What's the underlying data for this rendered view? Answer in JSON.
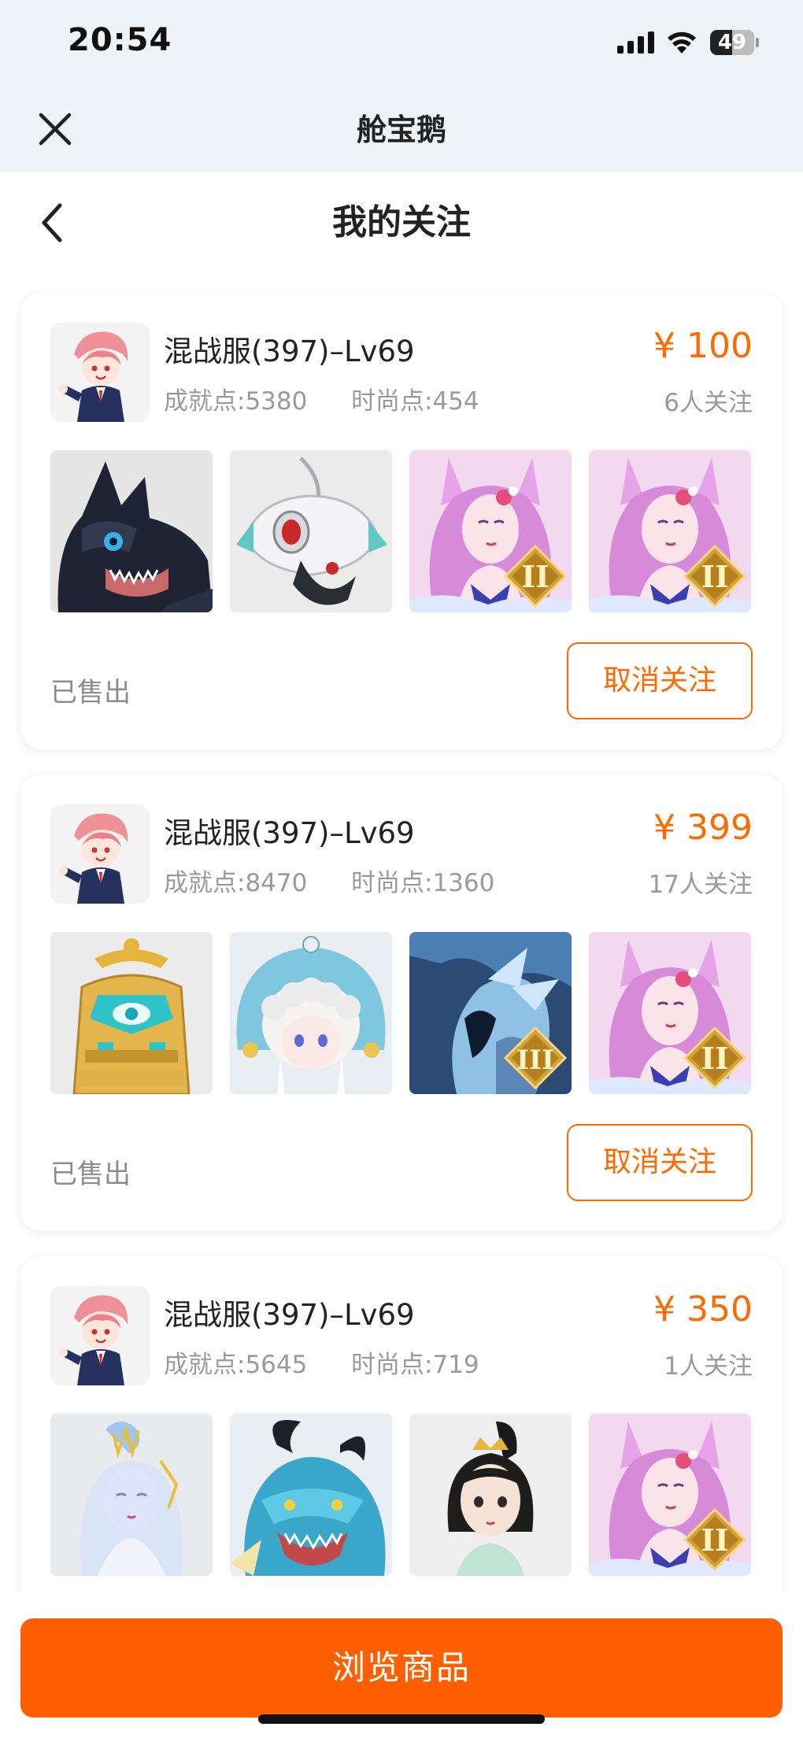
{
  "status_bar": {
    "time": "20:54",
    "battery": "49",
    "icons": [
      "signal-icon",
      "wifi-icon",
      "battery-icon"
    ]
  },
  "app_bar": {
    "title": "舱宝鹅",
    "close_icon": "close-icon"
  },
  "nav": {
    "title": "我的关注",
    "back_icon": "chevron-left-icon"
  },
  "cards": [
    {
      "title": "混战服(397)–Lv69",
      "achievement": "成就点:5380",
      "fashion": "时尚点:454",
      "price": "¥ 100",
      "followers": "6人关注",
      "status": "已售出",
      "action": "取消关注",
      "thumbnails": [
        "black-dragon-image",
        "white-mech-beast-image",
        "pink-fox-girl-tier-2-image",
        "pink-fox-girl-tier-2-image"
      ]
    },
    {
      "title": "混战服(397)–Lv69",
      "achievement": "成就点:8470",
      "fashion": "时尚点:1360",
      "price": "¥ 399",
      "followers": "17人关注",
      "status": "已售出",
      "action": "取消关注",
      "thumbnails": [
        "golden-throne-image",
        "blue-curly-hair-doll-image",
        "ice-dragon-knight-tier-3-image",
        "pink-fox-girl-tier-2-image"
      ]
    },
    {
      "title": "混战服(397)–Lv69",
      "achievement": "成就点:5645",
      "fashion": "时尚点:719",
      "price": "¥ 350",
      "followers": "1人关注",
      "thumbnails": [
        "white-haired-lady-image",
        "blue-horned-dragon-image",
        "black-haired-girl-image",
        "pink-fox-girl-tier-2-image"
      ]
    }
  ],
  "bottom_button": {
    "label": "浏览商品"
  },
  "colors": {
    "accent": "#ff6a00",
    "status_bar_bg": "#edf3f6",
    "muted_text": "#9a9a9a"
  }
}
